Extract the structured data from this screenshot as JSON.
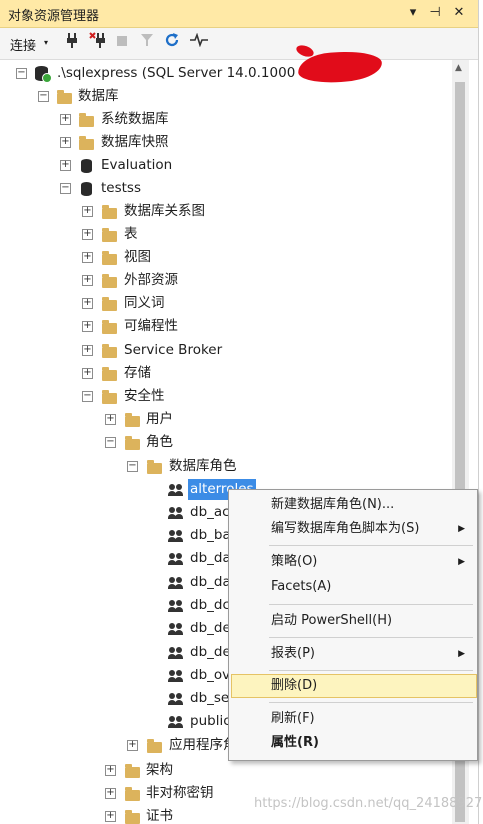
{
  "window": {
    "title": "对象资源管理器",
    "buttons": {
      "dropdown": "▾",
      "pin": "⊣",
      "close": "✕"
    }
  },
  "toolbar": {
    "connect_label": "连接",
    "connect_caret": "▾",
    "icons": [
      "plug-icon",
      "disconnect-icon",
      "stop-icon",
      "filter-icon",
      "refresh-icon",
      "activity-monitor-icon"
    ]
  },
  "tree": {
    "server": ".\\sqlexpress (SQL Server 14.0.1000",
    "databases": "数据库",
    "system_databases": "系统数据库",
    "snapshots": "数据库快照",
    "evaluation": "Evaluation",
    "testss": "testss",
    "children": [
      "数据库关系图",
      "表",
      "视图",
      "外部资源",
      "同义词",
      "可编程性",
      "Service Broker",
      "存储",
      "安全性"
    ],
    "security_children": {
      "users": "用户",
      "roles": "角色"
    },
    "db_roles": "数据库角色",
    "roles": [
      "alterroles",
      "db_ac",
      "db_ba",
      "db_da",
      "db_da",
      "db_dc",
      "db_de",
      "db_de",
      "db_ov",
      "db_se",
      "public"
    ],
    "app_roles": "应用程序角",
    "schemas": "架构",
    "asym_keys": "非对称密钥",
    "certs": "证书"
  },
  "context_menu": {
    "new_role": "新建数据库角色(N)...",
    "script_role": "编写数据库角色脚本为(S)",
    "policy": "策略(O)",
    "facets": "Facets(A)",
    "powershell": "启动 PowerShell(H)",
    "reports": "报表(P)",
    "delete": "删除(D)",
    "refresh": "刷新(F)",
    "properties": "属性(R)",
    "submenu_arrow": "▶"
  },
  "watermark": "https://blog.csdn.net/qq_24188927",
  "colors": {
    "title_bg": "#ffe9a6",
    "selection": "#3c8ce6",
    "menu_highlight": "#fdf4bf",
    "redaction": "#e10c1a"
  }
}
